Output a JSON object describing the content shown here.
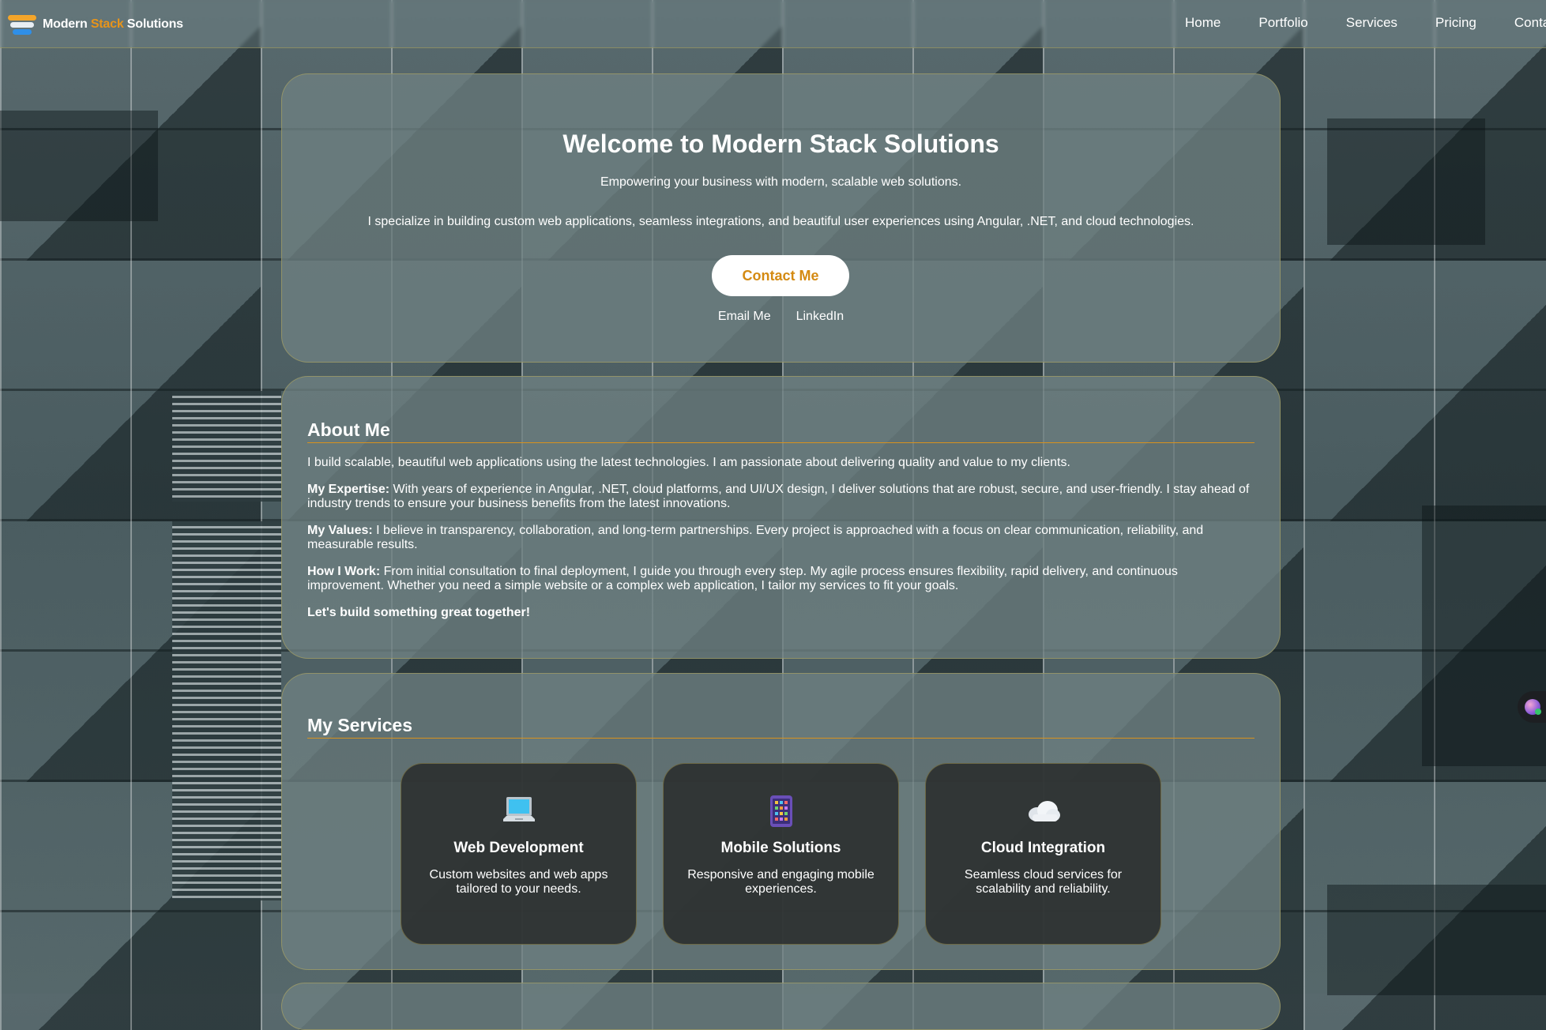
{
  "nav": {
    "brand_part1": "Modern",
    "brand_part2": "Stack",
    "brand_part3": "Solutions",
    "links": [
      "Home",
      "Portfolio",
      "Services",
      "Pricing",
      "Contact"
    ]
  },
  "hero": {
    "title": "Welcome to Modern Stack Solutions",
    "tagline": "Empowering your business with modern, scalable web solutions.",
    "description": "I specialize in building custom web applications, seamless integrations, and beautiful user experiences using Angular, .NET, and cloud technologies.",
    "cta_label": "Contact Me",
    "email_link": "Email Me",
    "linkedin_link": "LinkedIn"
  },
  "about": {
    "title": "About Me",
    "intro": "I build scalable, beautiful web applications using the latest technologies. I am passionate about delivering quality and value to my clients.",
    "expertise_label": "My Expertise:",
    "expertise_text": " With years of experience in Angular, .NET, cloud platforms, and UI/UX design, I deliver solutions that are robust, secure, and user-friendly. I stay ahead of industry trends to ensure your business benefits from the latest innovations.",
    "values_label": "My Values:",
    "values_text": " I believe in transparency, collaboration, and long-term partnerships. Every project is approached with a focus on clear communication, reliability, and measurable results.",
    "work_label": "How I Work:",
    "work_text": " From initial consultation to final deployment, I guide you through every step. My agile process ensures flexibility, rapid delivery, and continuous improvement. Whether you need a simple website or a complex web application, I tailor my services to fit your goals.",
    "closing": "Let's build something great together!"
  },
  "services": {
    "title": "My Services",
    "items": [
      {
        "icon": "laptop-icon",
        "title": "Web Development",
        "text": "Custom websites and web apps tailored to your needs."
      },
      {
        "icon": "mobile-icon",
        "title": "Mobile Solutions",
        "text": "Responsive and engaging mobile experiences."
      },
      {
        "icon": "cloud-icon",
        "title": "Cloud Integration",
        "text": "Seamless cloud services for scalability and reliability."
      }
    ]
  },
  "colors": {
    "accent": "#e8941a",
    "card_border": "#afa55f",
    "cta_text": "#d48a12"
  }
}
